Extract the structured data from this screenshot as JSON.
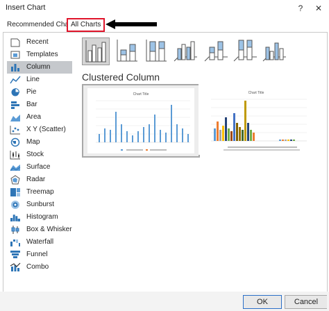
{
  "window": {
    "title": "Insert Chart",
    "help": "?",
    "close": "✕"
  },
  "tabs": [
    {
      "label": "Recommended Charts"
    },
    {
      "label": "All Charts"
    }
  ],
  "sidebar": {
    "items": [
      {
        "label": "Recent",
        "icon": "recent-icon"
      },
      {
        "label": "Templates",
        "icon": "templates-icon"
      },
      {
        "label": "Column",
        "icon": "column-chart-icon"
      },
      {
        "label": "Line",
        "icon": "line-chart-icon"
      },
      {
        "label": "Pie",
        "icon": "pie-chart-icon"
      },
      {
        "label": "Bar",
        "icon": "bar-chart-icon"
      },
      {
        "label": "Area",
        "icon": "area-chart-icon"
      },
      {
        "label": "X Y (Scatter)",
        "icon": "scatter-chart-icon"
      },
      {
        "label": "Map",
        "icon": "map-chart-icon"
      },
      {
        "label": "Stock",
        "icon": "stock-chart-icon"
      },
      {
        "label": "Surface",
        "icon": "surface-chart-icon"
      },
      {
        "label": "Radar",
        "icon": "radar-chart-icon"
      },
      {
        "label": "Treemap",
        "icon": "treemap-chart-icon"
      },
      {
        "label": "Sunburst",
        "icon": "sunburst-chart-icon"
      },
      {
        "label": "Histogram",
        "icon": "histogram-chart-icon"
      },
      {
        "label": "Box & Whisker",
        "icon": "box-whisker-chart-icon"
      },
      {
        "label": "Waterfall",
        "icon": "waterfall-chart-icon"
      },
      {
        "label": "Funnel",
        "icon": "funnel-chart-icon"
      },
      {
        "label": "Combo",
        "icon": "combo-chart-icon"
      }
    ],
    "selected_index": 2
  },
  "main": {
    "heading": "Clustered Column",
    "subtype_selected_index": 0,
    "preview1_title": "Chart Title",
    "preview2_title": "Chart Title"
  },
  "footer": {
    "ok": "OK",
    "cancel": "Cancel"
  },
  "colors": {
    "accent_red": "#e0142a",
    "bar_blue": "#5b9bd5",
    "orange": "#ed7d31",
    "gray": "#a5a5a5",
    "gold": "#ffc000",
    "navy": "#264478",
    "green": "#70ad47"
  }
}
